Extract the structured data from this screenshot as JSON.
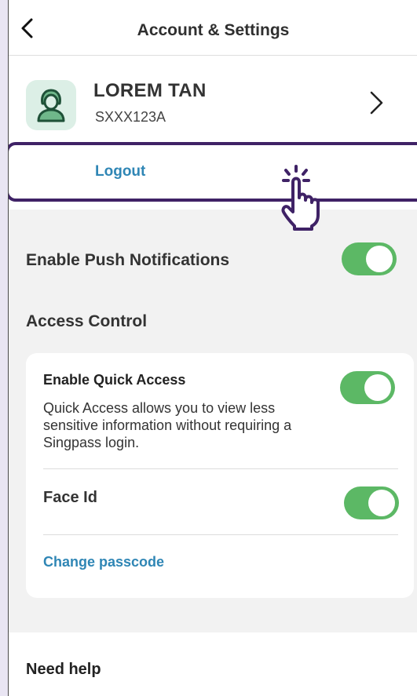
{
  "header": {
    "title": "Account & Settings",
    "back_icon": "chevron-left-icon"
  },
  "profile": {
    "name": "LOREM TAN",
    "id": "SXXX123A",
    "avatar_icon": "user-avatar-icon",
    "chevron_icon": "chevron-right-icon"
  },
  "logout": {
    "label": "Logout",
    "pointer_icon": "hand-pointer-icon"
  },
  "push": {
    "label": "Enable Push Notifications",
    "enabled": true
  },
  "access_control": {
    "section_title": "Access Control",
    "quick_access": {
      "title": "Enable Quick Access",
      "desc": "Quick Access allows you to view less sensitive information without requiring a Singpass login.",
      "enabled": true
    },
    "face_id": {
      "label": "Face Id",
      "enabled": true
    },
    "change_passcode": "Change passcode"
  },
  "help": {
    "label": "Need help"
  },
  "colors": {
    "accent_link": "#2f86b5",
    "toggle_on": "#5cb865",
    "highlight_border": "#3f2266",
    "avatar_bg": "#dcefe6"
  }
}
